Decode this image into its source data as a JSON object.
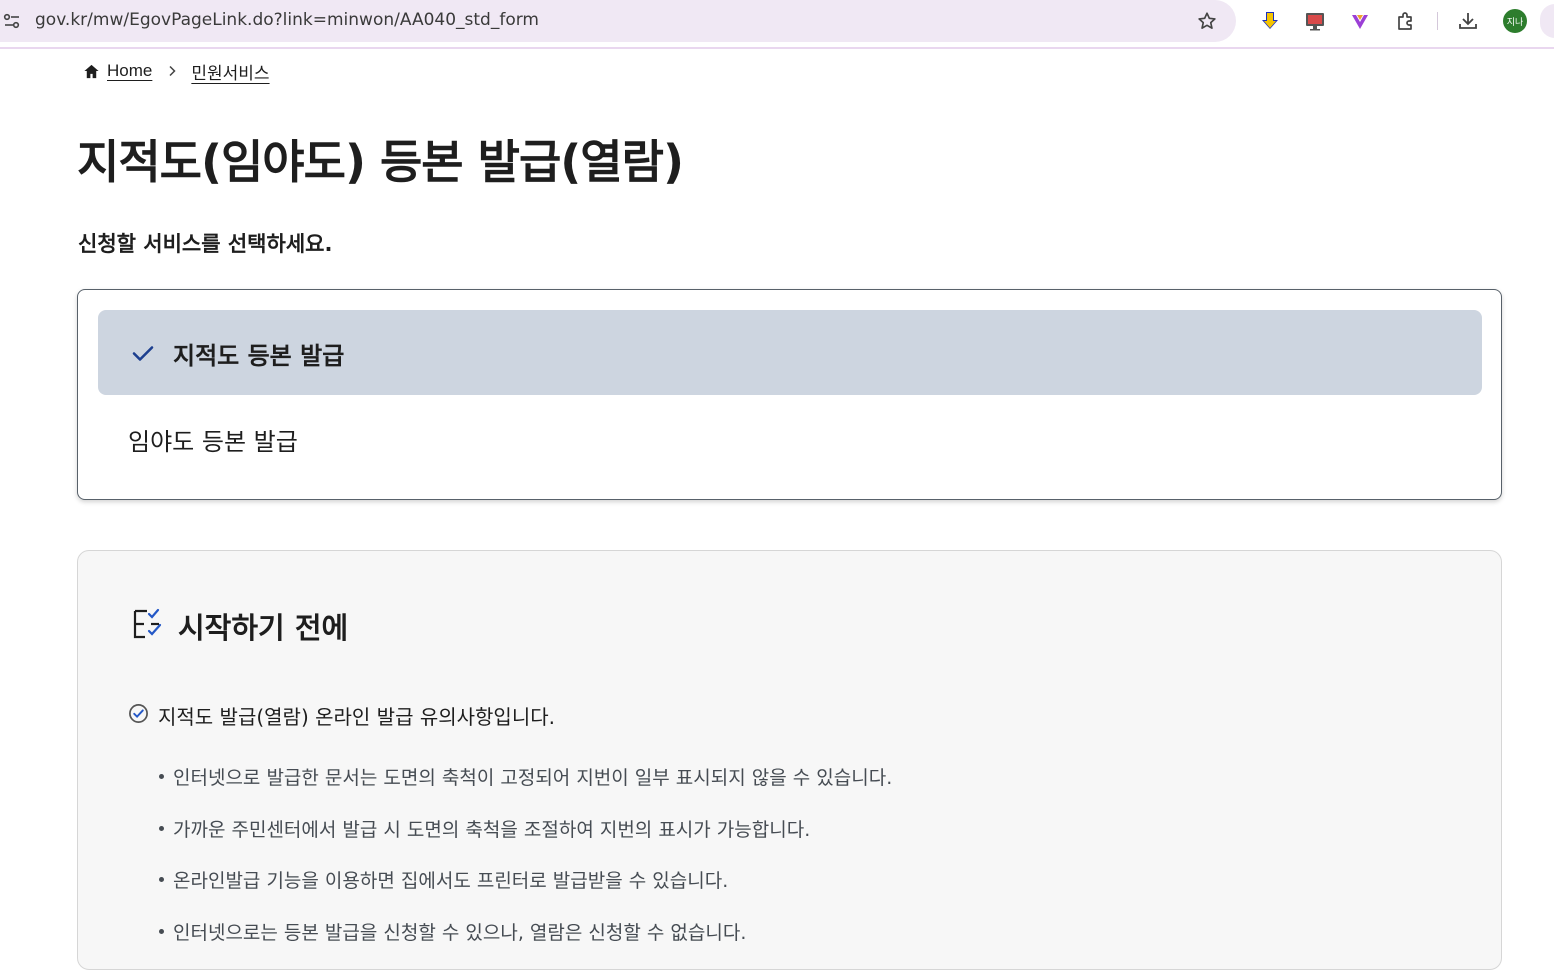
{
  "browser": {
    "url": "gov.kr/mw/EgovPageLink.do?link=minwon/AA040_std_form",
    "profile_initials": "지나"
  },
  "breadcrumb": {
    "home": "Home",
    "current": "민원서비스"
  },
  "page": {
    "title": "지적도(임야도) 등본 발급(열람)",
    "instruction": "신청할 서비스를 선택하세요."
  },
  "services": {
    "selected": "지적도 등본 발급",
    "other": "임야도 등본 발급"
  },
  "notice": {
    "title": "시작하기 전에",
    "subtitle": "지적도 발급(열람) 온라인 발급 유의사항입니다.",
    "items": [
      "인터넷으로 발급한 문서는 도면의 축척이 고정되어 지번이 일부 표시되지 않을 수 있습니다.",
      "가까운 주민센터에서 발급 시 도면의 축척을 조절하여 지번의 표시가 가능합니다.",
      "온라인발급 기능을 이용하면 집에서도 프린터로 발급받을 수 있습니다.",
      "인터넷으로는 등본 발급을 신청할 수 있으나, 열람은 신청할 수 없습니다."
    ]
  },
  "colors": {
    "selected_bg": "#cdd5e0",
    "check_blue": "#1c3f8f",
    "notice_bg": "#f7f7f7"
  }
}
